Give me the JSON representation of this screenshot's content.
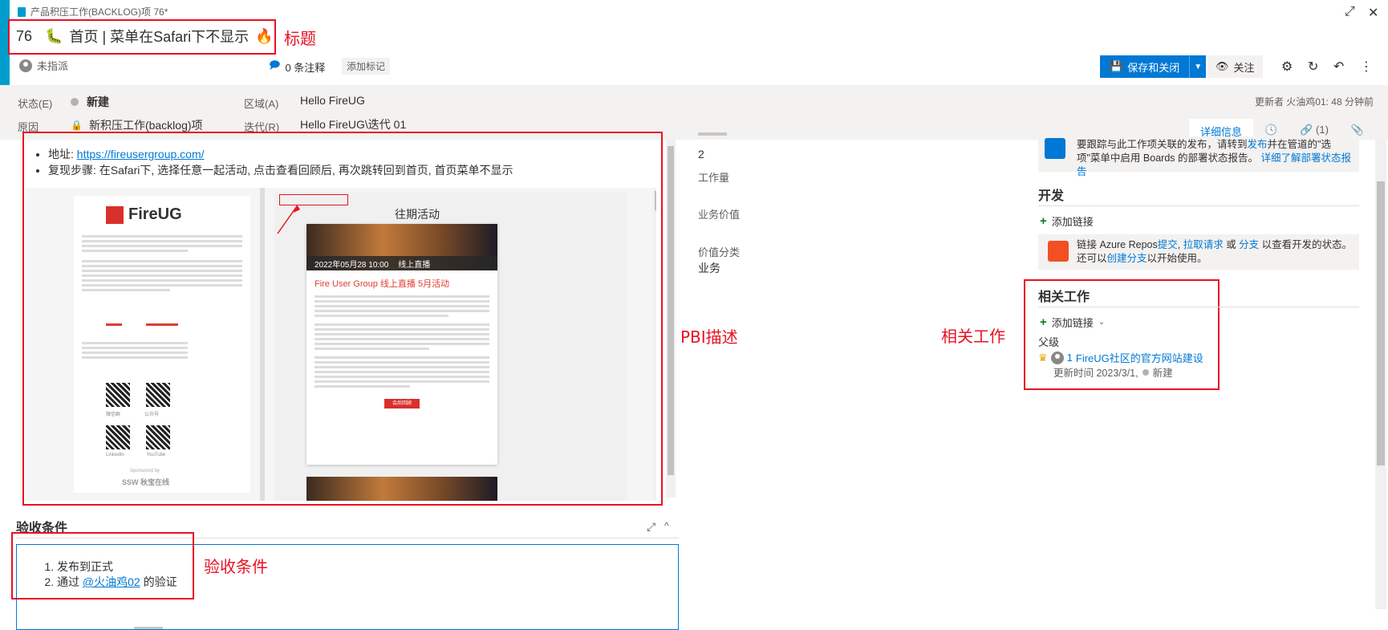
{
  "window": {
    "type_label": "产品积压工作(BACKLOG)项 76*",
    "expand_icon": "⤢",
    "close_icon": "✕"
  },
  "title": {
    "id": "76",
    "emoji_caterpillar": "🐛",
    "text": "首页 | 菜单在Safari下不显示",
    "emoji_fire": "🔥"
  },
  "annotations": {
    "title": "标题",
    "pbi": "PBI描述",
    "related": "相关工作",
    "acceptance": "验收条件"
  },
  "meta": {
    "assignee": "未指派",
    "comments": "0 条注释",
    "add_tag": "添加标记"
  },
  "toolbar": {
    "save_close": "保存和关闭",
    "follow": "关注"
  },
  "fields": {
    "state_label": "状态(E)",
    "state_value": "新建",
    "reason_label": "原因",
    "reason_value": "新积压工作(backlog)项",
    "area_label": "区域(A)",
    "area_value": "Hello FireUG",
    "iteration_label": "迭代(R)",
    "iteration_value": "Hello FireUG\\迭代 01",
    "updated_by": "更新者 火油鸡01: 48 分钟前"
  },
  "tabs": {
    "details": "详细信息",
    "links": "(1)"
  },
  "description": {
    "address_label": "地址: ",
    "address_url": "https://fireusergroup.com/",
    "steps": "复现步骤: 在Safari下, 选择任意一起活动, 点击查看回顾后, 再次跳转回到首页, 首页菜单不显示"
  },
  "embed": {
    "logo": "FireUG",
    "past_events": "往期活动",
    "card_date": "2022年05月28 10:00",
    "card_badge": "线上直播",
    "card_title": "Fire User Group 线上直播 5月活动",
    "qr_labels": [
      "微信群",
      "公众号",
      "LinkedIn",
      "YouTube"
    ],
    "sponsor": "Sponsored by",
    "sponsor_names": "SSW 秋宝在线",
    "card_button": "会后回顾"
  },
  "middle": {
    "value_2": "2",
    "effort_label": "工作量",
    "business_value_label": "业务价值",
    "value_area_label": "价值分类",
    "value_area_value": "业务"
  },
  "deployment": {
    "text_1": "要跟踪与此工作项关联的发布，请转到",
    "link_1": "发布",
    "text_2": "并在管道的\"选项\"菜单中启用 Boards 的部署状态报告。",
    "link_2": "详细了解部署状态报告"
  },
  "development": {
    "title": "开发",
    "add_link": "添加链接",
    "text_1": "链接 Azure Repos",
    "link_commit": "提交",
    "sep_1": ", ",
    "link_pr": "拉取请求",
    "text_or": " 或 ",
    "link_branch": "分支",
    "text_2": " 以查看开发的状态。还可以",
    "link_create": "创建分支",
    "text_3": "以开始使用。"
  },
  "related_work": {
    "title": "相关工作",
    "add_link": "添加链接",
    "parent_label": "父级",
    "item_id": "1",
    "item_title": "FireUG社区的官方网站建设",
    "item_meta": "更新时间 2023/3/1,",
    "item_state": "新建"
  },
  "acceptance": {
    "title": "验收条件",
    "item_1": "发布到正式",
    "item_2_prefix": "通过 ",
    "item_2_mention": "@火油鸡02",
    "item_2_suffix": " 的验证"
  },
  "colors": {
    "accent": "#009ccc",
    "primary": "#0078d4",
    "annotation": "#e81123"
  }
}
